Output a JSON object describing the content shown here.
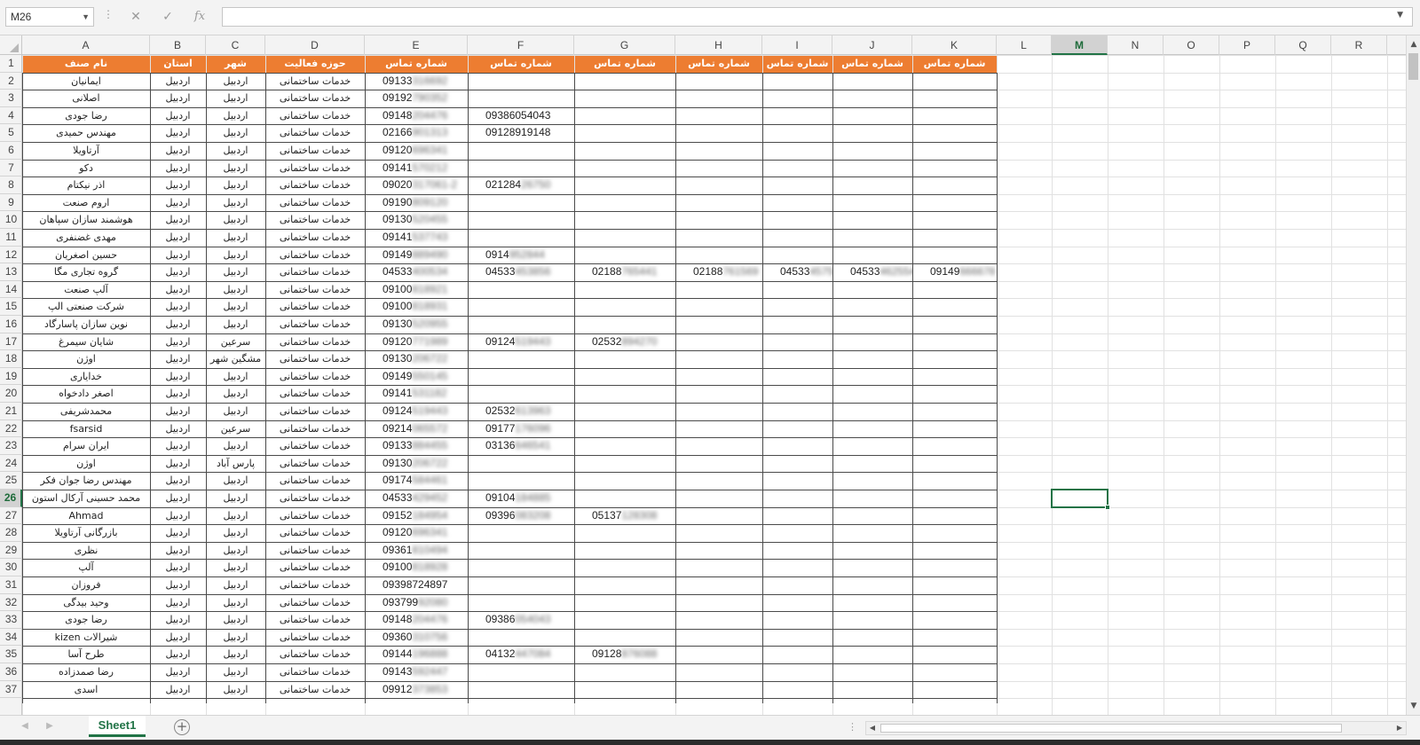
{
  "formula_bar": {
    "name_box": "M26",
    "cancel_icon": "✕",
    "enter_icon": "✓",
    "function_label": "fx",
    "formula": ""
  },
  "columns": [
    "A",
    "B",
    "C",
    "D",
    "E",
    "F",
    "G",
    "H",
    "I",
    "J",
    "K",
    "L",
    "M",
    "N",
    "O",
    "P",
    "Q",
    "R"
  ],
  "active_cell": {
    "column": "M",
    "row": 26
  },
  "header_row": [
    "نام صنف",
    "استان",
    "شهر",
    "حوزه فعالیت",
    "شماره تماس",
    "شماره تماس",
    "شماره تماس",
    "شماره تماس",
    "شماره تماس",
    "شماره تماس",
    "شماره تماس"
  ],
  "rows": [
    {
      "num": "2",
      "name": "ایمانیان",
      "province": "اردبیل",
      "city": "اردبیل",
      "field": "خدمات ساختمانی",
      "phones": [
        [
          "09133",
          "316692"
        ]
      ]
    },
    {
      "num": "3",
      "name": "اصلانی",
      "province": "اردبیل",
      "city": "اردبیل",
      "field": "خدمات ساختمانی",
      "phones": [
        [
          "09192",
          "790352"
        ]
      ]
    },
    {
      "num": "4",
      "name": "رضا جودی",
      "province": "اردبیل",
      "city": "اردبیل",
      "field": "خدمات ساختمانی",
      "phones": [
        [
          "09148",
          "204476"
        ],
        [
          "09386054043",
          ""
        ]
      ]
    },
    {
      "num": "5",
      "name": "مهندس حمیدی",
      "province": "اردبیل",
      "city": "اردبیل",
      "field": "خدمات ساختمانی",
      "phones": [
        [
          "02166",
          "901313"
        ],
        [
          "09128919148",
          ""
        ]
      ]
    },
    {
      "num": "6",
      "name": "آرتاویلا",
      "province": "اردبیل",
      "city": "اردبیل",
      "field": "خدمات ساختمانی",
      "phones": [
        [
          "09120",
          "696341"
        ]
      ]
    },
    {
      "num": "7",
      "name": "دکو",
      "province": "اردبیل",
      "city": "اردبیل",
      "field": "خدمات ساختمانی",
      "phones": [
        [
          "09141",
          "570212"
        ]
      ]
    },
    {
      "num": "8",
      "name": "اذر نیکتام",
      "province": "اردبیل",
      "city": "اردبیل",
      "field": "خدمات ساختمانی",
      "phones": [
        [
          "09020",
          "317061-2"
        ],
        [
          "021284",
          "26750"
        ]
      ]
    },
    {
      "num": "9",
      "name": "اروم صنعت",
      "province": "اردبیل",
      "city": "اردبیل",
      "field": "خدمات ساختمانی",
      "phones": [
        [
          "09190",
          "809120"
        ]
      ]
    },
    {
      "num": "10",
      "name": "هوشمند سازان سپاهان",
      "province": "اردبیل",
      "city": "اردبیل",
      "field": "خدمات ساختمانی",
      "phones": [
        [
          "09130",
          "520455"
        ]
      ]
    },
    {
      "num": "11",
      "name": "مهدی غضنفری",
      "province": "اردبیل",
      "city": "اردبیل",
      "field": "خدمات ساختمانی",
      "phones": [
        [
          "09141",
          "537743"
        ]
      ]
    },
    {
      "num": "12",
      "name": "حسین اصغریان",
      "province": "اردبیل",
      "city": "اردبیل",
      "field": "خدمات ساختمانی",
      "phones": [
        [
          "09149",
          "889490"
        ],
        [
          "0914",
          "952844"
        ]
      ]
    },
    {
      "num": "13",
      "name": "گروه تجاری مگا",
      "province": "اردبیل",
      "city": "اردبیل",
      "field": "خدمات ساختمانی",
      "phones": [
        [
          "04533",
          "400534"
        ],
        [
          "04533",
          "453856"
        ],
        [
          "02188",
          "765441"
        ],
        [
          "02188",
          "761569"
        ],
        [
          "04533",
          "457512"
        ],
        [
          "04533",
          "462554"
        ],
        [
          "09149",
          "666678"
        ]
      ]
    },
    {
      "num": "14",
      "name": "آلپ صنعت",
      "province": "اردبیل",
      "city": "اردبیل",
      "field": "خدمات ساختمانی",
      "phones": [
        [
          "09100",
          "818921"
        ]
      ]
    },
    {
      "num": "15",
      "name": "شرکت صنعتی الپ",
      "province": "اردبیل",
      "city": "اردبیل",
      "field": "خدمات ساختمانی",
      "phones": [
        [
          "09100",
          "818931"
        ]
      ]
    },
    {
      "num": "16",
      "name": "نوین سازان پاسارگاد",
      "province": "اردبیل",
      "city": "اردبیل",
      "field": "خدمات ساختمانی",
      "phones": [
        [
          "09130",
          "520955"
        ]
      ]
    },
    {
      "num": "17",
      "name": "شایان سیمرغ",
      "province": "اردبیل",
      "city": "سرعین",
      "field": "خدمات ساختمانی",
      "phones": [
        [
          "09120",
          "771989"
        ],
        [
          "09124",
          "519443"
        ],
        [
          "02532",
          "894270"
        ]
      ]
    },
    {
      "num": "18",
      "name": "اوژن",
      "province": "اردبیل",
      "city": "مشگین شهر",
      "field": "خدمات ساختمانی",
      "phones": [
        [
          "09130",
          "206722"
        ]
      ]
    },
    {
      "num": "19",
      "name": "خدایاری",
      "province": "اردبیل",
      "city": "اردبیل",
      "field": "خدمات ساختمانی",
      "phones": [
        [
          "09149",
          "550145"
        ]
      ]
    },
    {
      "num": "20",
      "name": "اصغر دادخواه",
      "province": "اردبیل",
      "city": "اردبیل",
      "field": "خدمات ساختمانی",
      "phones": [
        [
          "09141",
          "531182"
        ]
      ]
    },
    {
      "num": "21",
      "name": "محمدشریفی",
      "province": "اردبیل",
      "city": "اردبیل",
      "field": "خدمات ساختمانی",
      "phones": [
        [
          "09124",
          "519443"
        ],
        [
          "02532",
          "613963"
        ]
      ]
    },
    {
      "num": "22",
      "name": "fsarsid",
      "province": "اردبیل",
      "city": "سرعین",
      "field": "خدمات ساختمانی",
      "phones": [
        [
          "09214",
          "065572"
        ],
        [
          "09177",
          "176096"
        ]
      ]
    },
    {
      "num": "23",
      "name": "ایران سرام",
      "province": "اردبیل",
      "city": "اردبیل",
      "field": "خدمات ساختمانی",
      "phones": [
        [
          "09133",
          "884455"
        ],
        [
          "03136",
          "646541"
        ]
      ]
    },
    {
      "num": "24",
      "name": "اوژن",
      "province": "اردبیل",
      "city": "پارس آباد",
      "field": "خدمات ساختمانی",
      "phones": [
        [
          "09130",
          "206722"
        ]
      ]
    },
    {
      "num": "25",
      "name": "مهندس رضا جوان فکر",
      "province": "اردبیل",
      "city": "اردبیل",
      "field": "خدمات ساختمانی",
      "phones": [
        [
          "09174",
          "584461"
        ]
      ]
    },
    {
      "num": "26",
      "name": "محمد حسینی  آرکال استون",
      "province": "اردبیل",
      "city": "اردبیل",
      "field": "خدمات ساختمانی",
      "phones": [
        [
          "04533",
          "429452"
        ],
        [
          "09104",
          "184885"
        ]
      ]
    },
    {
      "num": "27",
      "name": "Ahmad",
      "province": "اردبیل",
      "city": "اردبیل",
      "field": "خدمات ساختمانی",
      "phones": [
        [
          "09152",
          "184954"
        ],
        [
          "09396",
          "083208"
        ],
        [
          "05137",
          "128308"
        ]
      ]
    },
    {
      "num": "28",
      "name": "بازرگانی آرتاویلا",
      "province": "اردبیل",
      "city": "اردبیل",
      "field": "خدمات ساختمانی",
      "phones": [
        [
          "09120",
          "696341"
        ]
      ]
    },
    {
      "num": "29",
      "name": "نظری",
      "province": "اردبیل",
      "city": "اردبیل",
      "field": "خدمات ساختمانی",
      "phones": [
        [
          "09361",
          "810494"
        ]
      ]
    },
    {
      "num": "30",
      "name": "آلپ",
      "province": "اردبیل",
      "city": "اردبیل",
      "field": "خدمات ساختمانی",
      "phones": [
        [
          "09100",
          "818928"
        ]
      ]
    },
    {
      "num": "31",
      "name": "فروزان",
      "province": "اردبیل",
      "city": "اردبیل",
      "field": "خدمات ساختمانی",
      "phones": [
        [
          "09398724897",
          ""
        ]
      ]
    },
    {
      "num": "32",
      "name": "وحید بیدگی",
      "province": "اردبیل",
      "city": "اردبیل",
      "field": "خدمات ساختمانی",
      "phones": [
        [
          "093799",
          "92080"
        ]
      ]
    },
    {
      "num": "33",
      "name": "رضا جودی",
      "province": "اردبیل",
      "city": "اردبیل",
      "field": "خدمات ساختمانی",
      "phones": [
        [
          "09148",
          "204476"
        ],
        [
          "09386",
          "054043"
        ]
      ]
    },
    {
      "num": "34",
      "name": "شیرالات kizen",
      "province": "اردبیل",
      "city": "اردبیل",
      "field": "خدمات ساختمانی",
      "phones": [
        [
          "09360",
          "310756"
        ]
      ]
    },
    {
      "num": "35",
      "name": "طرح آسا",
      "province": "اردبیل",
      "city": "اردبیل",
      "field": "خدمات ساختمانی",
      "phones": [
        [
          "09144",
          "196888"
        ],
        [
          "04132",
          "447084"
        ],
        [
          "09128",
          "876088"
        ]
      ]
    },
    {
      "num": "36",
      "name": "رضا صمدزاده",
      "province": "اردبیل",
      "city": "اردبیل",
      "field": "خدمات ساختمانی",
      "phones": [
        [
          "09143",
          "592447"
        ]
      ]
    },
    {
      "num": "37",
      "name": "اسدی",
      "province": "اردبیل",
      "city": "اردبیل",
      "field": "خدمات ساختمانی",
      "phones": [
        [
          "09912",
          "373853"
        ]
      ]
    }
  ],
  "sheet_tabs": [
    "Sheet1"
  ],
  "add_sheet_label": "+",
  "colors": {
    "header_fill": "#ed7d31",
    "accent": "#217346"
  },
  "icons": {
    "cancel": "close-icon",
    "enter": "check-icon",
    "add_sheet": "plus-circle-icon"
  }
}
